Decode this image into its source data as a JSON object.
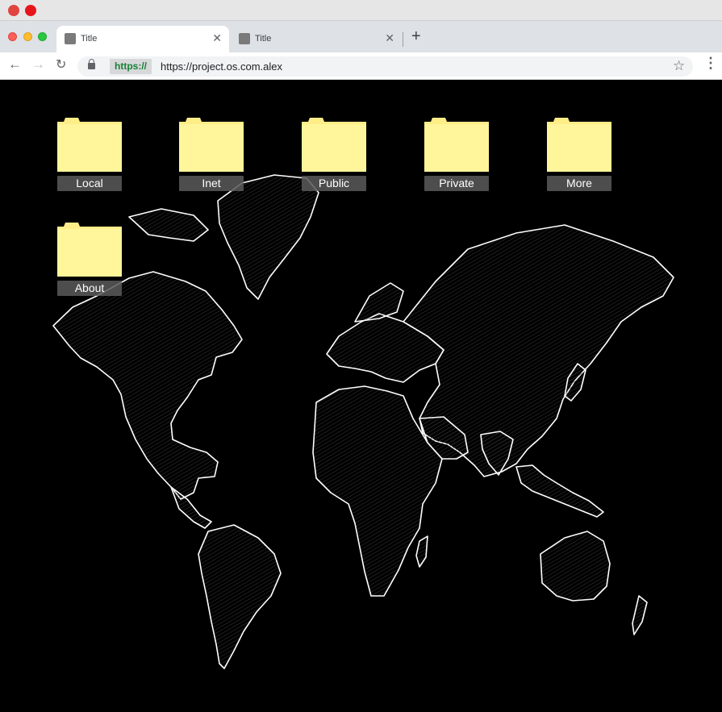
{
  "browser": {
    "tabs": [
      {
        "title": "Title",
        "close": "✕"
      },
      {
        "title": "Title",
        "close": "✕"
      }
    ],
    "new_tab": "+",
    "nav": {
      "back": "←",
      "forward": "→",
      "reload": "↻"
    },
    "address": {
      "scheme": "https://",
      "url": "https://project.os.com.alex"
    },
    "star": "☆",
    "menu": "⋮"
  },
  "desktop": {
    "folders": [
      {
        "label": "Local",
        "icon": "folder-icon"
      },
      {
        "label": "Inet",
        "icon": "folder-icon"
      },
      {
        "label": "Public",
        "icon": "folder-icon"
      },
      {
        "label": "Private",
        "icon": "folder-icon"
      },
      {
        "label": "More",
        "icon": "folder-icon"
      },
      {
        "label": "About",
        "icon": "folder-icon"
      }
    ],
    "folder_color": "#fff59b",
    "folder_tab_color": "#ffee88",
    "background": "world-map",
    "background_color": "#000000",
    "map_outline_color": "#ffffff"
  }
}
